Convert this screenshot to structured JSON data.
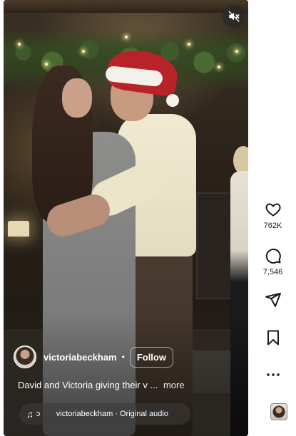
{
  "post": {
    "author": "victoriabeckham",
    "separator": "•",
    "follow_label": "Follow",
    "caption": "David and Victoria giving their v ...",
    "more_label": "more",
    "audio_marquee": "ɔ",
    "audio_text": "victoriabeckham · Original audio"
  },
  "actions": {
    "likes": "762K",
    "comments": "7,546"
  },
  "icons": {
    "mute": "speaker-muted-icon",
    "like": "heart-icon",
    "comment": "comment-bubble-icon",
    "share": "paper-plane-icon",
    "save": "bookmark-icon",
    "more": "more-dots-icon",
    "audio": "music-note-icon"
  },
  "colors": {
    "overlay_text": "#ffffff",
    "icon_stroke": "#1a1a1a",
    "hat_red": "#b8232a"
  }
}
